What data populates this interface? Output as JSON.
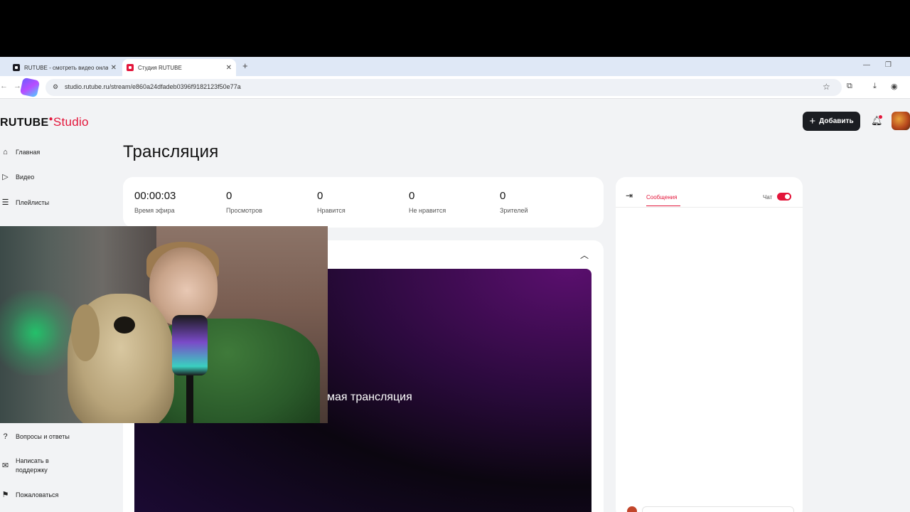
{
  "browser": {
    "tabs": [
      {
        "title": "RUTUBE - смотреть видео онлайн",
        "active": false
      },
      {
        "title": "Студия RUTUBE",
        "active": true
      }
    ],
    "new_tab": "+",
    "url": "studio.rutube.ru/stream/e860a24dfadeb0396f9182123f50e77a"
  },
  "header": {
    "logo_main": "RUTUBE",
    "logo_sub": "Studio",
    "add_button": "Добавить"
  },
  "sidebar": {
    "items": [
      {
        "label": "Главная",
        "icon": "home-icon"
      },
      {
        "label": "Видео",
        "icon": "video-icon"
      },
      {
        "label": "Плейлисты",
        "icon": "playlist-icon"
      }
    ],
    "bottom_items": [
      {
        "label": "Вопросы и ответы",
        "icon": "question-icon"
      },
      {
        "label": "Написать в поддержку",
        "icon": "mail-icon"
      },
      {
        "label": "Пожаловаться",
        "icon": "flag-icon"
      }
    ]
  },
  "main": {
    "title": "Трансляция",
    "stats": [
      {
        "value": "00:00:03",
        "label": "Время эфира"
      },
      {
        "value": "0",
        "label": "Просмотров"
      },
      {
        "value": "0",
        "label": "Нравится"
      },
      {
        "value": "0",
        "label": "Не нравится"
      },
      {
        "value": "0",
        "label": "Зрителей"
      }
    ],
    "player_text": "мая трансляция"
  },
  "chat": {
    "tab_label": "Сообщения",
    "toggle_label": "Чат",
    "toggle_on": true
  },
  "colors": {
    "accent": "#e3153a",
    "page_bg": "#f2f3f5",
    "button_dark": "#1b1d22"
  }
}
